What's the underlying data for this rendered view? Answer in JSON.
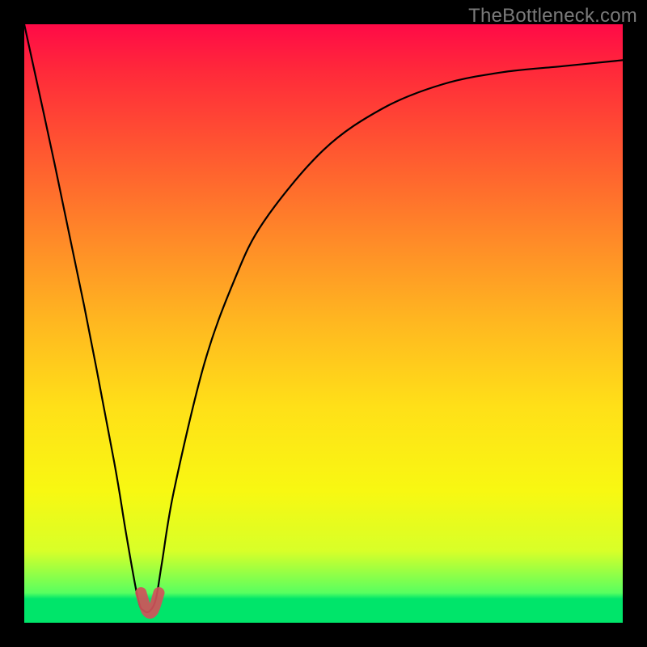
{
  "watermark": "TheBottleneck.com",
  "chart_data": {
    "type": "line",
    "title": "",
    "xlabel": "",
    "ylabel": "",
    "xlim": [
      0,
      1
    ],
    "ylim": [
      0,
      1
    ],
    "series": [
      {
        "name": "curve",
        "x": [
          0.0,
          0.05,
          0.1,
          0.15,
          0.17,
          0.19,
          0.2,
          0.21,
          0.22,
          0.23,
          0.25,
          0.3,
          0.35,
          0.4,
          0.5,
          0.6,
          0.7,
          0.8,
          0.9,
          1.0
        ],
        "values": [
          1.0,
          0.77,
          0.53,
          0.27,
          0.15,
          0.04,
          0.02,
          0.02,
          0.04,
          0.1,
          0.22,
          0.43,
          0.57,
          0.67,
          0.79,
          0.86,
          0.9,
          0.92,
          0.93,
          0.94
        ]
      }
    ],
    "marker": {
      "note": "small rounded red-pink cluster near the curve minimum",
      "color": "#d0525a",
      "points_x": [
        0.195,
        0.205,
        0.215,
        0.225
      ],
      "points_y": [
        0.05,
        0.02,
        0.02,
        0.05
      ]
    },
    "gradient_note": "background encodes value: red=top(high), green=bottom(low)"
  }
}
